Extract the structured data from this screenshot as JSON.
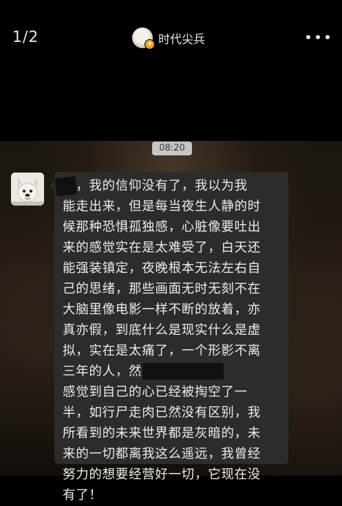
{
  "header": {
    "page_indicator": "1/2",
    "account_name": "时代尖兵",
    "more_icon": "more-dots-icon",
    "badge_icon": "verified-badge-icon",
    "badge_color": "#f3a21a"
  },
  "chat": {
    "timestamp": "08:20",
    "sender_avatar_icon": "french-bulldog-avatar",
    "message_lines": [
      "哥，我的信仰没有了，我以为我",
      "能走出来，但是每当夜生人静的时",
      "候那种恐惧孤独感，心脏像要吐出",
      "来的感觉实在是太难受了，白天还",
      "能强装镇定，夜晚根本无法左右自",
      "己的思绪，那些画面无时无刻不在",
      "大脑里像电影一样不断的放着，亦",
      "真亦假，到底什么是现实什么是虚",
      "拟，实在是太痛了，一个形影不离",
      "三年的人，然                   不是我，我",
      "感觉到自己的心已经被掏空了一",
      "半，如行尸走肉已然没有区别，我",
      "所看到的未来世界都是灰暗的，未",
      "来的一切都离我这么遥远，我曾经",
      "努力的想要经营好一切，它现在没",
      "有了！"
    ]
  }
}
